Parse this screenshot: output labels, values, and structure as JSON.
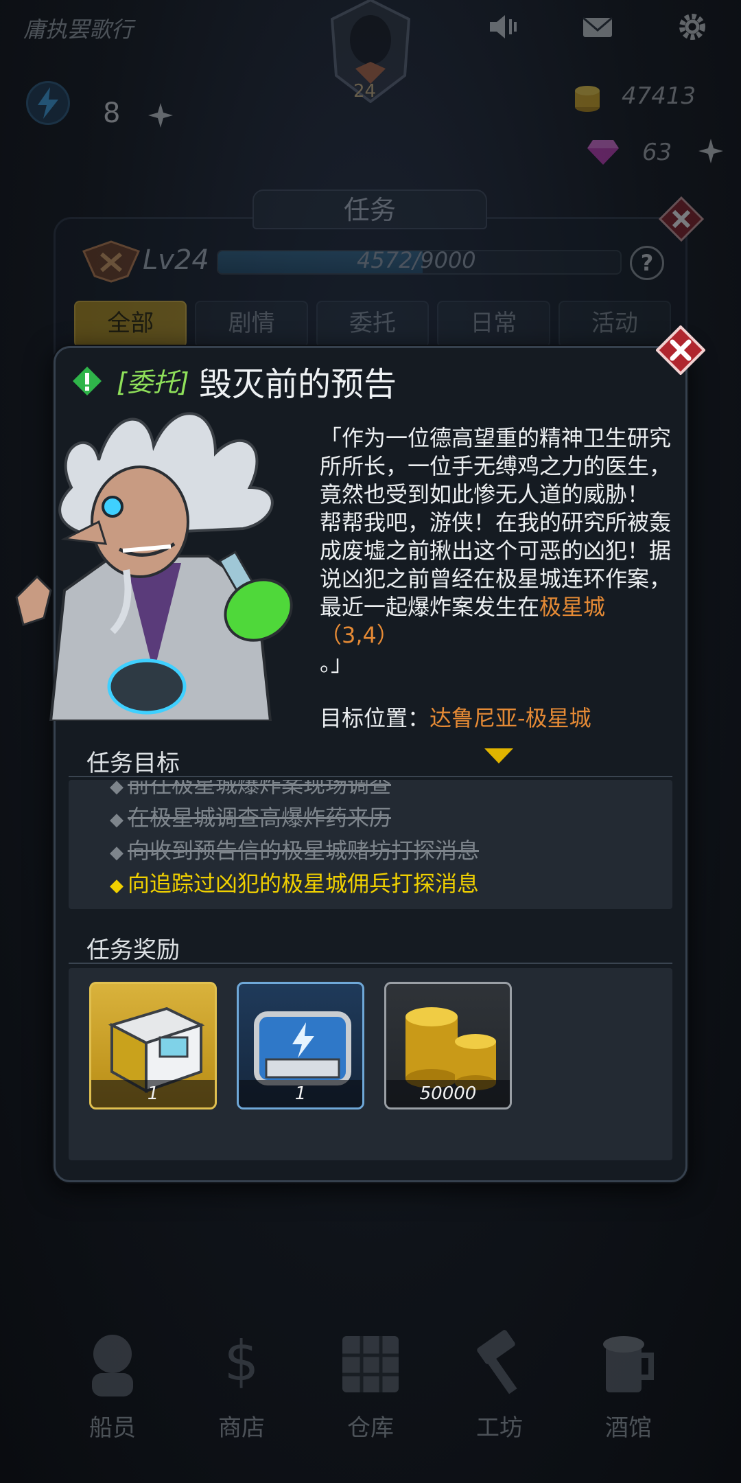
{
  "header": {
    "player_name": "庸执罢歌行",
    "avatar_level": "24",
    "energy": "8",
    "coins": "47413",
    "gems": "63"
  },
  "panel": {
    "title": "任务",
    "level": "Lv24",
    "xp_text": "4572/9000",
    "xp_fraction": 0.508,
    "help": "?",
    "filters": [
      "全部",
      "剧情",
      "委托",
      "日常",
      "活动"
    ],
    "active_filter": "全部"
  },
  "quest": {
    "category": "[委托]",
    "title": "毁灭前的预告",
    "story_p1": "「作为一位德高望重的精神卫生研究所所长，一位手无缚鸡之力的医生，竟然也受到如此惨无人道的威胁！",
    "story_p2": "帮帮我吧，游侠！在我的研究所被轰成废墟之前揪出这个可恶的凶犯！据说凶犯之前曾经在极星城连环作案，最近一起爆炸案发生在",
    "story_location": "极星城（3,4）",
    "story_end": "。」",
    "target_label": "目标位置：",
    "target_value": "达鲁尼亚-极星城"
  },
  "objectives": {
    "heading": "任务目标",
    "items": [
      {
        "text": "前往极星城爆炸案现场调查",
        "state": "done"
      },
      {
        "text": "在极星城调查高爆炸药来历",
        "state": "done"
      },
      {
        "text": "向收到预告信的极星城赌坊打探消息",
        "state": "done"
      },
      {
        "text": "向追踪过凶犯的极星城佣兵打探消息",
        "state": "current"
      }
    ]
  },
  "rewards": {
    "heading": "任务奖励",
    "items": [
      {
        "name": "supply-crate-icon",
        "count": "1",
        "frame": "#e0c050"
      },
      {
        "name": "energy-cell-icon",
        "count": "1",
        "frame": "#6fa8d8"
      },
      {
        "name": "gold-coins-icon",
        "count": "50000",
        "frame": "#9a9fa5"
      }
    ]
  },
  "bottom_nav": [
    "船员",
    "商店",
    "仓库",
    "工坊",
    "酒馆"
  ],
  "colors": {
    "accent_gold": "#b4901c",
    "quest_category": "#8fe05a",
    "location_highlight": "#e58a35",
    "current_objective": "#f0d000"
  }
}
